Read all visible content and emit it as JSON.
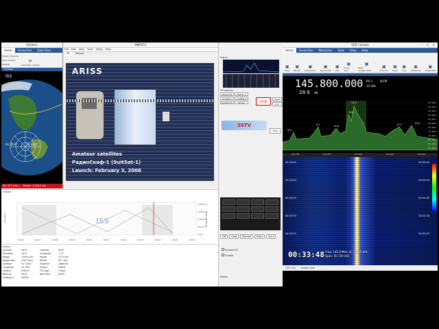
{
  "orbitron": {
    "title": "Orbitron",
    "tabs": [
      "Home",
      "Favourites",
      "Data Files",
      "Rotor",
      "View",
      "Display",
      "Help"
    ],
    "ribbon": [
      "Enable Tracking",
      "Rotor Lat/Lon",
      "Refresh",
      "Automatic Update",
      "Passes Predictor",
      "Rotors"
    ],
    "sections": [
      "Connect",
      "Tracking"
    ],
    "sat_name": "ISS",
    "az": "Az 30.6°",
    "el": "El 14.4°",
    "alt": "Alt: 417.0 km",
    "range": "Range: 1,249.4 km",
    "chart_title": "Tracker",
    "chart_watermark": "ISS",
    "y_left_label": "Elevation",
    "y_right_label": "Altitude, Range",
    "y_right_ticks": [
      "3,000 km",
      "2,000 km",
      "1,500 km",
      "750 km",
      "0 km"
    ],
    "x_ticks": [
      "00:26",
      "00:27",
      "00:28",
      "00:29",
      "00:30",
      "00:31",
      "00:32",
      "00:33",
      "00:34",
      "00:35",
      "00:36"
    ],
    "status_title": "Status",
    "status": [
      {
        "k": "Azimuth",
        "v": "30.6°",
        "k2": "Latitude",
        "v2": "50.6°"
      },
      {
        "k": "Elevation",
        "v": "14.4°",
        "k2": "Longitude",
        "v2": "-1.3°"
      },
      {
        "k": "Range",
        "v": "1249.4 km",
        "k2": "Height",
        "v2": "417.0 km"
      },
      {
        "k": "Range rate",
        "v": "-6.87 km/s",
        "k2": "Period",
        "v2": "92.7 min"
      },
      {
        "k": "Latitude",
        "v": "51° 26.6'",
        "k2": "Footprint",
        "v2": "4488 km"
      },
      {
        "k": "Longitude",
        "v": "-0° 58.1'",
        "k2": "Eclipse",
        "v2": "Visible"
      },
      {
        "k": "Locator",
        "v": "IO91ml",
        "k2": "TCA Age",
        "v2": "0 days"
      },
      {
        "k": "Bearing",
        "v": "30.6°",
        "k2": "Next Pass",
        "v2": "00:45"
      },
      {
        "k": "Catalog #",
        "v": "25544",
        "k2": "",
        "v2": ""
      }
    ]
  },
  "sstv": {
    "title": "MMSSTV",
    "menu": [
      "File",
      "Edit",
      "View",
      "Tools",
      "Setup",
      "Help"
    ],
    "tabs": [
      "RX",
      "History"
    ],
    "img_title": "ARISS",
    "img_line1": "Amateur satellites",
    "img_line2": "РадиоСкаф-1 (SuitSat-1)",
    "img_line3": "Launch: February 3, 2006",
    "side_title": "Signal",
    "options_title": "RX options",
    "mode_btns": [
      "Robot 36",
      "Martin 1",
      "Scottie 1",
      "Scottie 2",
      "Scottie DX",
      "PD120"
    ],
    "stop_btn": "STOP",
    "reset_btn": "Reset",
    "sync_btn": "Sync",
    "logo_text": "SSTV",
    "exit_btn": "Exit",
    "bottom_tabs": [
      "Off",
      "Auto",
      "Manual",
      "Slant",
      "Sync"
    ],
    "checks": [
      "Enable AFC",
      "Enable"
    ],
    "status_line": "Ready"
  },
  "sdr": {
    "title": "SDR Console",
    "tabs": [
      "Home",
      "Favourites",
      "Memories",
      "Tools",
      "View",
      "Help"
    ],
    "ribbon": [
      "Start",
      "Blocks",
      "Modulation",
      "Bandwidth",
      "AGC",
      "Visual Gain",
      "Radio Configuration",
      "Previous",
      "Redo",
      "Lock",
      "Wideband",
      "PowerSDR"
    ],
    "freq": "145.800.000",
    "rx_label": "RX 1",
    "mode": "N-FM",
    "bw": "12 kHz",
    "signal": "29.9",
    "signal_unit": "dB",
    "db_scale": [
      "-35 dBm",
      "-40 dBm",
      "-45 dBm",
      "-50 dBm",
      "-55 dBm",
      "-60 dBm",
      "-65 dBm",
      "-70 dBm",
      "-75 dBm",
      "-80 dBm",
      "-85 dBm",
      "-90 dBm"
    ],
    "peak_labels": [
      "6.4",
      "8.7",
      "12.6",
      "24.3",
      "19.0",
      "11.1",
      "13.4"
    ],
    "freq_ticks": [
      "145.760",
      "145.780",
      "145.800",
      "145.820",
      "145.840"
    ],
    "clock": "00:33:48",
    "info1": "Freq: 145.8 MHz, Δ: -1.245 kHz",
    "info2": "Span: 60.720 kHz",
    "wf_time_labels": [
      "00:33:45",
      "00:33:40",
      "00:33:35",
      "00:33:30",
      "00:33:25"
    ],
    "status_items": [
      "CPU: 4%",
      "Audio: Line"
    ]
  },
  "colors": {
    "accent": "#2b5797",
    "signal_green": "#7bd04a",
    "sstv_red": "#d23b2f"
  }
}
